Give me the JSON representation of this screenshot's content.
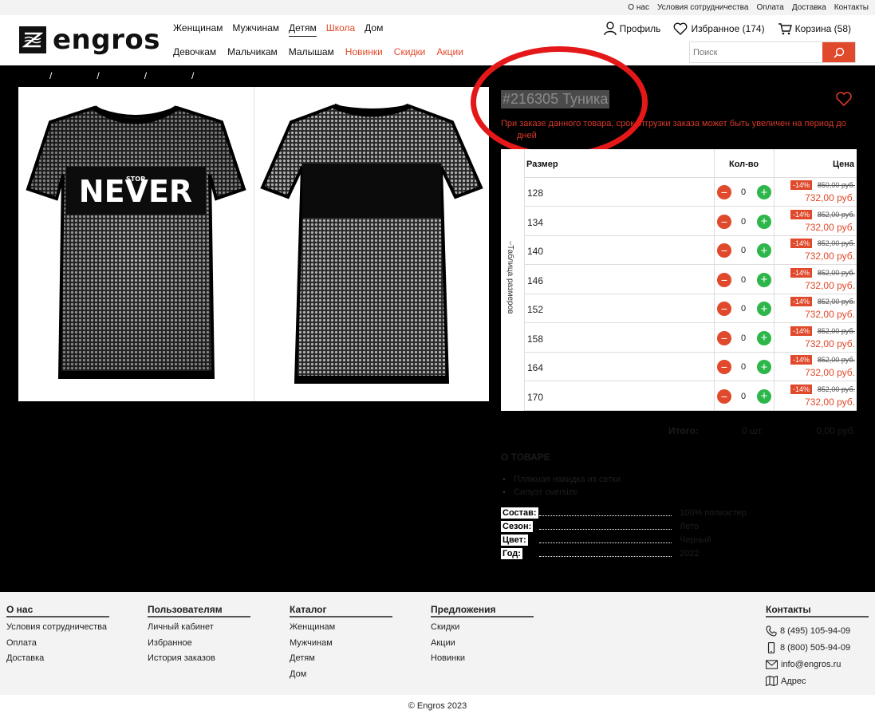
{
  "topbar": {
    "links": [
      "О нас",
      "Условия сотрудничества",
      "Оплата",
      "Доставка",
      "Контакты"
    ]
  },
  "header": {
    "logo_text": "engros",
    "nav_primary": [
      "Женщинам",
      "Мужчинам",
      "Детям",
      "Школа",
      "Дом"
    ],
    "nav_secondary": [
      "Девочкам",
      "Мальчикам",
      "Малышам",
      "Новинки",
      "Скидки",
      "Акции"
    ],
    "profile": "Профиль",
    "favorites": "Избранное (174)",
    "cart": "Корзина (58)",
    "search_placeholder": "Поиск",
    "accent_color": "#e0492b"
  },
  "breadcrumbs": [
    "/",
    "/",
    "/",
    "/"
  ],
  "product": {
    "title": "#216305 Туника",
    "notice": "При заказе данного товара, срок отгрузки заказа может быть увеличен на период до",
    "notice_tail": "дней",
    "print_text": "NEVER",
    "print_small": "STOP"
  },
  "size_table": {
    "side_tab": "Таблица размеров",
    "headers": {
      "size": "Размер",
      "qty": "Кол-во",
      "price": "Цена"
    },
    "rows": [
      {
        "size": "128",
        "qty": "0",
        "discount": "-14%",
        "old": "850,00 руб.",
        "price": "732,00 руб."
      },
      {
        "size": "134",
        "qty": "0",
        "discount": "-14%",
        "old": "852,00 руб.",
        "price": "732,00 руб."
      },
      {
        "size": "140",
        "qty": "0",
        "discount": "-14%",
        "old": "852,00 руб.",
        "price": "732,00 руб."
      },
      {
        "size": "146",
        "qty": "0",
        "discount": "-14%",
        "old": "852,00 руб.",
        "price": "732,00 руб."
      },
      {
        "size": "152",
        "qty": "0",
        "discount": "-14%",
        "old": "852,00 руб.",
        "price": "732,00 руб."
      },
      {
        "size": "158",
        "qty": "0",
        "discount": "-14%",
        "old": "852,00 руб.",
        "price": "732,00 руб."
      },
      {
        "size": "164",
        "qty": "0",
        "discount": "-14%",
        "old": "852,00 руб.",
        "price": "732,00 руб."
      },
      {
        "size": "170",
        "qty": "0",
        "discount": "-14%",
        "old": "852,00 руб.",
        "price": "732,00 руб."
      }
    ]
  },
  "totals": {
    "label": "Итого:",
    "count": "0 шт.",
    "sum": "0,00 руб."
  },
  "about": {
    "heading": "О ТОВАРЕ",
    "bullets": [
      "Пляжная накидка из сетки",
      "Силуэт oversize"
    ],
    "props": [
      {
        "k": "Состав:",
        "v": "100% полиэстер"
      },
      {
        "k": "Сезон:",
        "v": "Лето"
      },
      {
        "k": "Цвет:",
        "v": "Черный"
      },
      {
        "k": "Год:",
        "v": "2022"
      }
    ]
  },
  "footer": {
    "cols": [
      {
        "h": "О нас",
        "items": [
          "Условия сотрудничества",
          "Оплата",
          "Доставка"
        ]
      },
      {
        "h": "Пользователям",
        "items": [
          "Личный кабинет",
          "Избранное",
          "История заказов"
        ]
      },
      {
        "h": "Каталог",
        "items": [
          "Женщинам",
          "Мужчинам",
          "Детям",
          "Дом"
        ]
      },
      {
        "h": "Предложения",
        "items": [
          "Скидки",
          "Акции",
          "Новинки"
        ]
      }
    ],
    "contacts_h": "Контакты",
    "phone1": "8 (495) 105-94-09",
    "phone2": "8 (800) 505-94-09",
    "email": "info@engros.ru",
    "address": "Адрес",
    "copyright": "© Engros 2023"
  }
}
